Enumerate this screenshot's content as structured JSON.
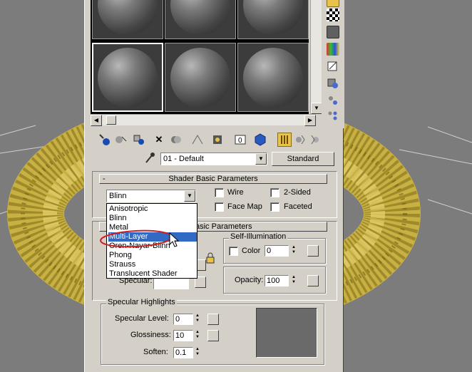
{
  "material": {
    "name": "01 - Default",
    "type_button": "Standard"
  },
  "shader_rollout": {
    "title": "Shader Basic Parameters",
    "collapse_glyph": "-",
    "shader_value": "Blinn",
    "options": {
      "wire": "Wire",
      "two_sided": "2-Sided",
      "face_map": "Face Map",
      "faceted": "Faceted"
    }
  },
  "dropdown": {
    "items": [
      "Anisotropic",
      "Blinn",
      "Metal",
      "Multi-Layer",
      "Oren-Nayar-Blinn",
      "Phong",
      "Strauss",
      "Translucent Shader"
    ],
    "highlighted": "Multi-Layer"
  },
  "blinn_rollout": {
    "title_visible": "asic Parameters",
    "specular_label": "Specular:",
    "self_illum": {
      "group_label": "Self-Illumination",
      "color_label": "Color",
      "value": "0"
    },
    "opacity": {
      "label": "Opacity:",
      "value": "100"
    }
  },
  "specular_highlights": {
    "group_label": "Specular Highlights",
    "level_label": "Specular Level:",
    "level_value": "0",
    "gloss_label": "Glossiness:",
    "gloss_value": "10",
    "soften_label": "Soften:",
    "soften_value": "0.1"
  },
  "colors": {
    "panel": "#d4d0c8",
    "highlight": "#316ac5",
    "active_tool": "#e9c24a",
    "torus": "#c8b042",
    "annotation_circle": "#cc1e1e"
  },
  "icons": {
    "eyedropper": "eyedropper-icon",
    "dropdown_arrow": "chevron-down-icon",
    "lock": "lock-icon"
  }
}
